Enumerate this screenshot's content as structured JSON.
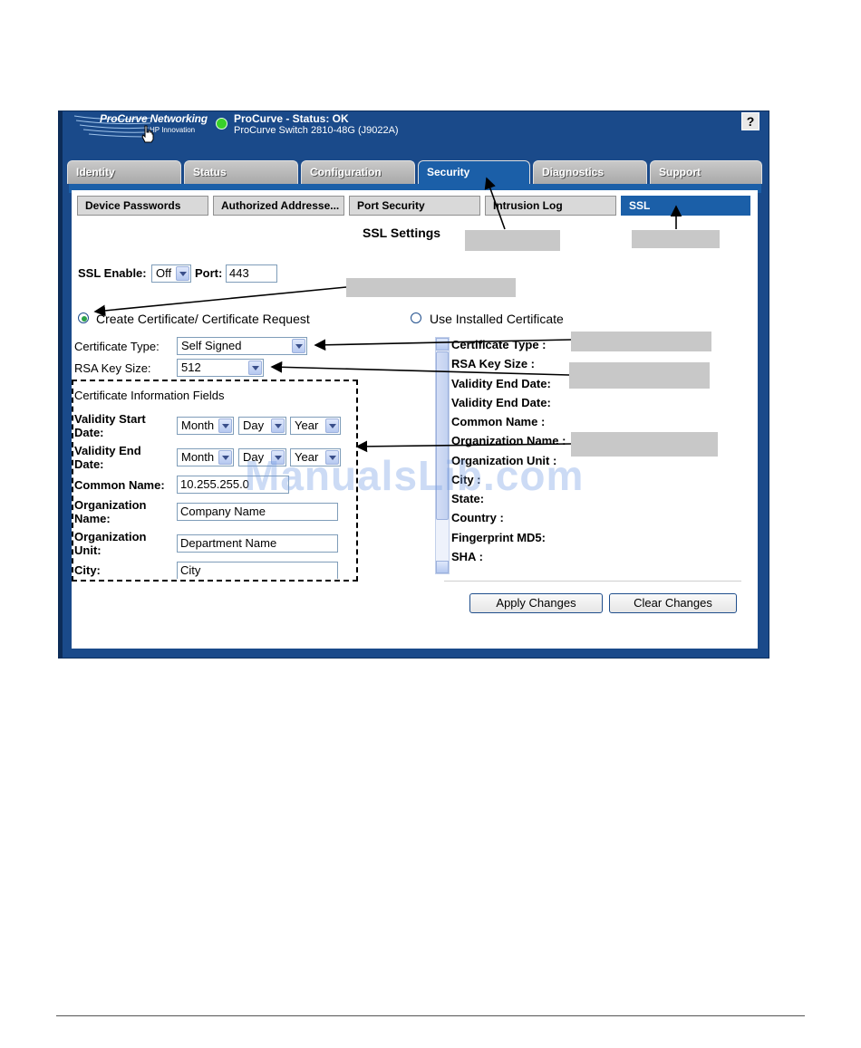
{
  "header": {
    "logo_title": "ProCurve Networking",
    "logo_sub": "HP Innovation",
    "status_line1": "ProCurve -  Status: OK",
    "status_line2": "ProCurve Switch 2810-48G (J9022A)",
    "help": "?",
    "status_color": "#39d02a"
  },
  "tabs": [
    {
      "label": "Identity"
    },
    {
      "label": "Status"
    },
    {
      "label": "Configuration"
    },
    {
      "label": "Security"
    },
    {
      "label": "Diagnostics"
    },
    {
      "label": "Support"
    }
  ],
  "active_tab": "Security",
  "subtabs": [
    {
      "label": "Device Passwords"
    },
    {
      "label": "Authorized Addresse..."
    },
    {
      "label": "Port Security"
    },
    {
      "label": "Intrusion Log"
    },
    {
      "label": "SSL"
    }
  ],
  "active_subtab": "SSL",
  "page": {
    "title": "SSL Settings",
    "ssl_enable_label": "SSL Enable:",
    "ssl_enable_value": "Off",
    "port_label": "Port:",
    "port_value": "443",
    "radio_create": "Create Certificate/ Certificate Request",
    "radio_installed": "Use Installed Certificate",
    "radio_selected": "create",
    "cert_type_label": "Certificate Type:",
    "cert_type_value": "Self Signed",
    "rsa_label": "RSA Key  Size:",
    "rsa_value": "512",
    "fields_heading": "Certificate Information Fields",
    "validity_start_label_1": "Validity Start",
    "validity_start_label_2": "Date:",
    "validity_end_label_1": "Validity End",
    "validity_end_label_2": "Date:",
    "month": "Month",
    "day": "Day",
    "year": "Year",
    "common_name_label": "Common Name:",
    "common_name_value": "10.255.255.0",
    "org_name_label_1": "Organization",
    "org_name_label_2": "Name:",
    "org_name_value": "Company Name",
    "org_unit_label_1": "Organization",
    "org_unit_label_2": "Unit:",
    "org_unit_value": "Department Name",
    "city_label": "City:",
    "city_value": "City"
  },
  "installed_cert": [
    "Certificate Type :",
    "RSA Key Size :",
    "Validity End Date:",
    "Validity End Date:",
    "Common Name :",
    "Organization Name :",
    "Organization Unit :",
    "City :",
    "State:",
    "Country :",
    "Fingerprint MD5:",
    "SHA :"
  ],
  "buttons": {
    "apply": "Apply Changes",
    "clear": "Clear Changes"
  },
  "watermark": "ManualsLib.com"
}
